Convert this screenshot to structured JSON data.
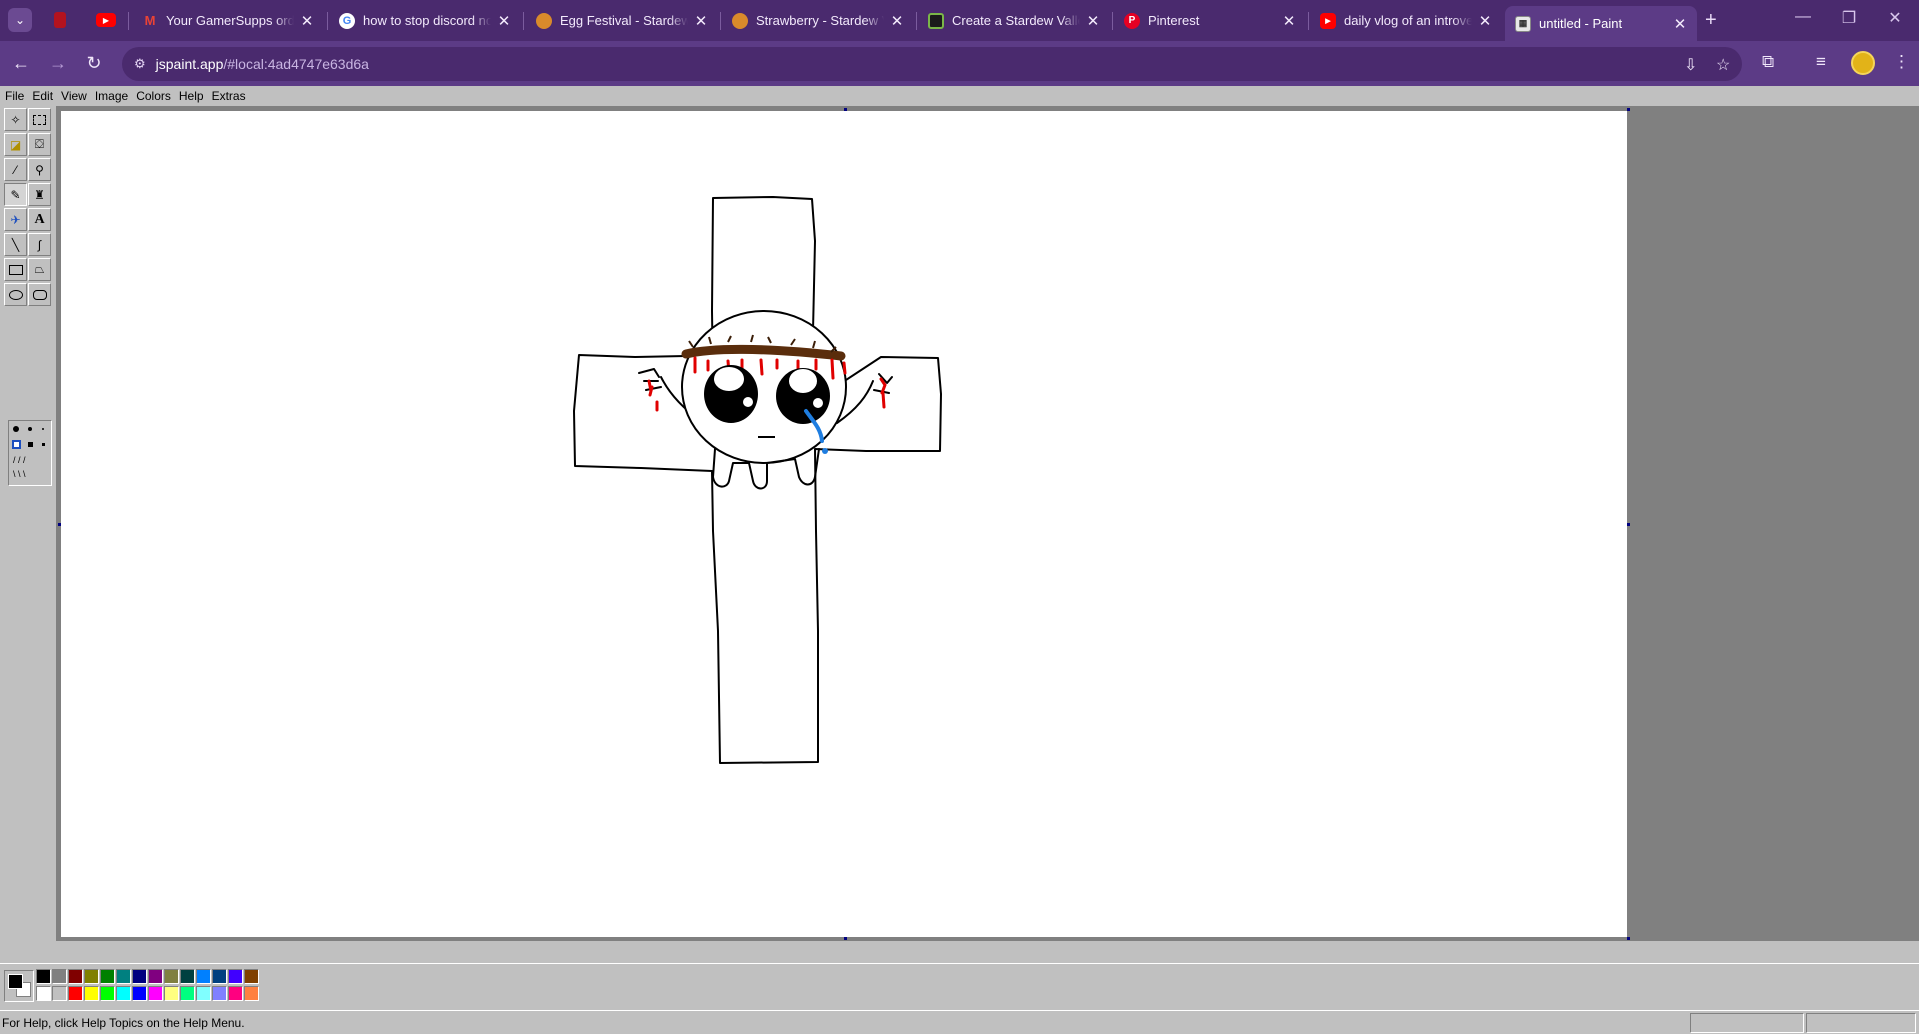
{
  "browser": {
    "tabs": [
      {
        "title": "",
        "favicon": "red-icon",
        "pinned": true
      },
      {
        "title": "",
        "favicon": "youtube-icon",
        "pinned": true
      },
      {
        "title": "Your GamerSupps order",
        "favicon": "gmail-icon",
        "active": false
      },
      {
        "title": "how to stop discord not",
        "favicon": "google-icon",
        "active": false
      },
      {
        "title": "Egg Festival - Stardew Valley",
        "favicon": "stardew-icon",
        "active": false
      },
      {
        "title": "Strawberry - Stardew Valley",
        "favicon": "stardew-icon",
        "active": false
      },
      {
        "title": "Create a Stardew Valley",
        "favicon": "stardew-planner-icon",
        "active": false
      },
      {
        "title": "Pinterest",
        "favicon": "pinterest-icon",
        "active": false
      },
      {
        "title": "daily vlog of an introvert",
        "favicon": "youtube-icon",
        "active": false
      },
      {
        "title": "untitled - Paint",
        "favicon": "jspaint-icon",
        "active": true
      }
    ],
    "url_host": "jspaint.app",
    "url_rest": "/#local:4ad4747e63d6a",
    "colors": {
      "frame": "#4a2a6e",
      "toolbar": "#5c3b86"
    }
  },
  "paint": {
    "menu": [
      "File",
      "Edit",
      "View",
      "Image",
      "Colors",
      "Help",
      "Extras"
    ],
    "tools": [
      "free-form-select",
      "select",
      "eraser",
      "fill-with-color",
      "pick-color",
      "magnifier",
      "pencil",
      "brush",
      "airbrush",
      "text",
      "line",
      "curve",
      "rectangle",
      "polygon",
      "ellipse",
      "rounded-rectangle"
    ],
    "selected_tool": "pencil",
    "palette_top": [
      "#000000",
      "#808080",
      "#800000",
      "#808000",
      "#008000",
      "#008080",
      "#000080",
      "#800080",
      "#808040",
      "#004040",
      "#0080ff",
      "#004080",
      "#4000ff",
      "#804000"
    ],
    "palette_bottom": [
      "#ffffff",
      "#c0c0c0",
      "#ff0000",
      "#ffff00",
      "#00ff00",
      "#00ffff",
      "#0000ff",
      "#ff00ff",
      "#ffff80",
      "#00ff80",
      "#80ffff",
      "#8080ff",
      "#ff0080",
      "#ff8040"
    ],
    "foreground_color": "#000000",
    "background_color": "#ffffff",
    "status_text": "For Help, click Help Topics on the Help Menu."
  }
}
